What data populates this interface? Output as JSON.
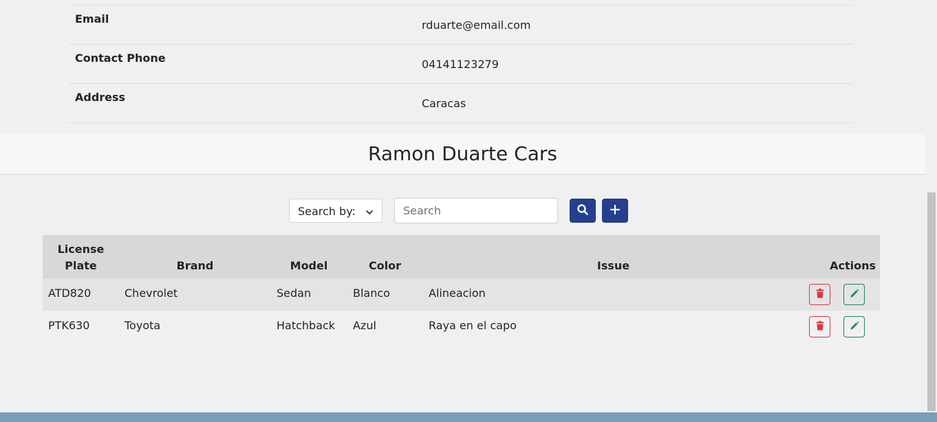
{
  "owner_info": {
    "rows": [
      {
        "label": "Email",
        "value": "rduarte@email.com"
      },
      {
        "label": "Contact Phone",
        "value": "04141123279"
      },
      {
        "label": "Address",
        "value": "Caracas"
      }
    ]
  },
  "cars_section": {
    "title": "Ramon Duarte Cars"
  },
  "toolbar": {
    "search_by_label": "Search by:",
    "search_placeholder": "Search",
    "search_icon": "search-icon",
    "add_icon": "plus-icon"
  },
  "table": {
    "headers": {
      "plate_line1": "License",
      "plate_line2": "Plate",
      "brand": "Brand",
      "model": "Model",
      "color": "Color",
      "issue": "Issue",
      "actions": "Actions"
    },
    "rows": [
      {
        "plate": "ATD820",
        "brand": "Chevrolet",
        "model": "Sedan",
        "color": "Blanco",
        "issue": "Alineacion"
      },
      {
        "plate": "PTK630",
        "brand": "Toyota",
        "model": "Hatchback",
        "color": "Azul",
        "issue": "Raya en el capo"
      }
    ],
    "delete_icon": "trash-icon",
    "edit_icon": "pencil-icon"
  },
  "colors": {
    "primary": "#253f8f",
    "danger": "#dc3545",
    "success": "#198754",
    "footer": "#7a9fb8"
  }
}
